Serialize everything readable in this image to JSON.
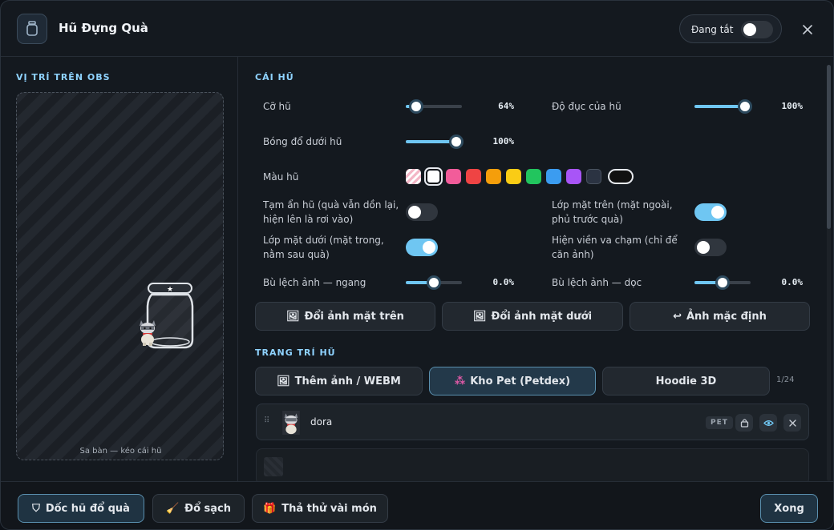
{
  "header": {
    "title": "Hũ Đựng Quà",
    "status_label": "Đang tắt",
    "status_on": false
  },
  "left_panel": {
    "title": "VỊ TRÍ TRÊN OBS",
    "sandbox_caption": "Sa bàn — kéo cái hũ"
  },
  "jar_section": {
    "title": "CÁI HŨ",
    "size": {
      "label": "Cỡ hũ",
      "value_text": "64%",
      "level": 0.18
    },
    "opacity": {
      "label": "Độ đục của hũ",
      "value_text": "100%",
      "level": 0.9
    },
    "shadow": {
      "label": "Bóng đổ dưới hũ",
      "value_text": "100%",
      "level": 0.9
    },
    "color_label": "Màu hũ",
    "colors": [
      "#ffffff",
      "#f25c9a",
      "#ef4444",
      "#f59e0b",
      "#facc15",
      "#22c55e",
      "#3b9cf0",
      "#a855f7",
      "#2b3342"
    ],
    "hide_jar": {
      "label_line1": "Tạm ẩn hũ (quà vẫn dồn lại,",
      "label_line2": "hiện lên là rơi vào)",
      "on": false
    },
    "top_layer": {
      "label_line1": "Lớp mặt trên (mặt ngoài,",
      "label_line2": "phủ trước quà)",
      "on": true
    },
    "bottom_layer": {
      "label_line1": "Lớp mặt dưới (mặt trong,",
      "label_line2": "nằm sau quà)",
      "on": true
    },
    "collision": {
      "label_line1": "Hiện viền va chạm (chỉ để",
      "label_line2": "căn ảnh)",
      "on": false
    },
    "offset_h": {
      "label": "Bù lệch ảnh — ngang",
      "value_text": "0.0%",
      "level": 0.5
    },
    "offset_v": {
      "label": "Bù lệch ảnh — dọc",
      "value_text": "0.0%",
      "level": 0.5
    },
    "buttons": {
      "change_top": "Đổi ảnh mặt trên",
      "change_bottom": "Đổi ảnh mặt dưới",
      "default_image": "Ảnh mặc định"
    }
  },
  "decor_section": {
    "title": "TRANG TRÍ HŨ",
    "tabs": {
      "add_image": "Thêm ảnh / WEBM",
      "pet_store": "Kho Pet (Petdex)",
      "hoodie": "Hoodie 3D"
    },
    "count": "1/24",
    "items": [
      {
        "name": "dora",
        "badge": "PET"
      }
    ]
  },
  "footer": {
    "pour": "Dốc hũ đổ quà",
    "clear": "Đổ sạch",
    "test_drop": "Thả thử vài món",
    "done": "Xong"
  }
}
